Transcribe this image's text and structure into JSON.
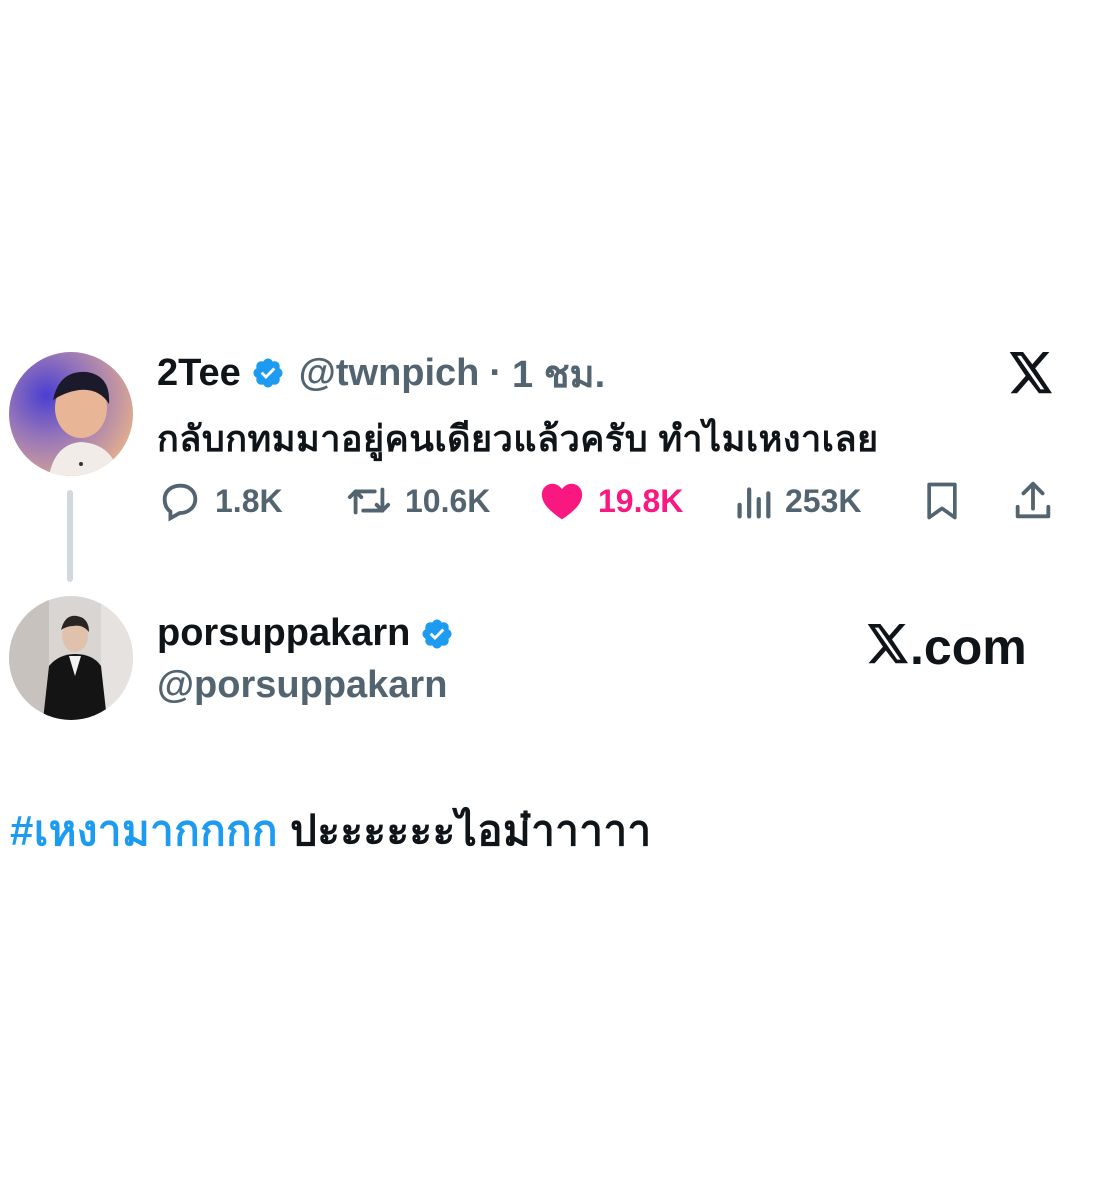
{
  "tweet": {
    "display_name": "2Tee",
    "handle": "@twnpich",
    "separator": "·",
    "time": "1 ชม.",
    "text": "กลับกทมมาอยู่คนเดียวแล้วครับ ทำไมเหงาเลย",
    "stats": {
      "replies": "1.8K",
      "reposts": "10.6K",
      "likes": "19.8K",
      "views": "253K"
    },
    "icons": [
      "reply-icon",
      "repost-icon",
      "heart-icon",
      "views-icon",
      "bookmark-icon",
      "share-icon",
      "x-logo-icon",
      "verified-badge-icon"
    ],
    "colors": {
      "like": "#f91880",
      "verified": "#1d9bf0",
      "muted": "#536471"
    }
  },
  "reply_author": {
    "display_name": "porsuppakarn",
    "handle": "@porsuppakarn"
  },
  "watermark": {
    "text": ".com"
  },
  "caption": {
    "hashtag": "#เหงามากกกก",
    "text": "ปะะะะะะไอม๋าาาาา"
  }
}
